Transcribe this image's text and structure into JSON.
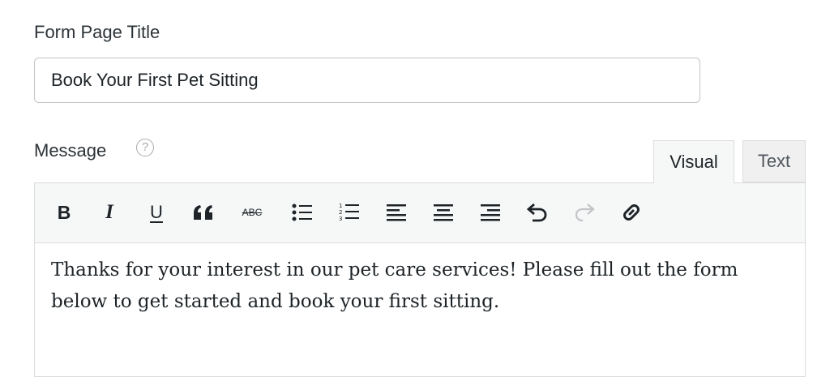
{
  "form_page_title": {
    "label": "Form Page Title",
    "value": "Book Your First Pet Sitting"
  },
  "message": {
    "label": "Message",
    "help_icon": "question-circle-icon"
  },
  "editor": {
    "tabs": [
      {
        "label": "Visual",
        "active": true
      },
      {
        "label": "Text",
        "active": false
      }
    ],
    "toolbar": [
      "bold",
      "italic",
      "underline",
      "blockquote",
      "strikethrough",
      "bulleted-list",
      "numbered-list",
      "align-left",
      "align-center",
      "align-right",
      "undo",
      "redo",
      "link"
    ],
    "toolbar_glyphs": {
      "bold": "B",
      "italic": "I",
      "underline": "U",
      "strikethrough": "ABC"
    },
    "content": "Thanks for your interest in our pet care services! Please fill out the form below to get started and book your first sitting."
  }
}
